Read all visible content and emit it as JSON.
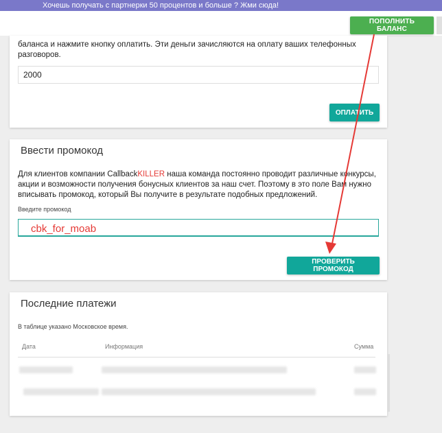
{
  "promo_banner": {
    "text": "Хочешь получать с партнерки 50 процентов и больше ? Жми сюда!"
  },
  "header": {
    "topup_button": "ПОПОЛНИТЬ БАЛАНС"
  },
  "payment_card": {
    "description": "баланса и нажмите кнопку оплатить. Эти деньги зачисляются на оплату ваших телефонных разговоров.",
    "amount_value": "2000",
    "pay_button": "ОПЛАТИТЬ"
  },
  "promo_card": {
    "title": "Ввести промокод",
    "text_before": "Для клиентов компании Callback",
    "text_brand": "KILLER",
    "text_after": " наша команда постоянно проводит различные конкурсы, акции и возможности получения бонусных клиентов за наш счет. Поэтому в это поле Вам нужно вписывать промокод, который Вы получите в результате подобных предложений.",
    "field_label": "Введите промокод",
    "promo_value": "cbk_for_moab",
    "check_button": "ПРОВЕРИТЬ ПРОМОКОД"
  },
  "payments_card": {
    "title": "Последние платежи",
    "note": "В таблице указано Московское время.",
    "columns": [
      "Дата",
      "Информация",
      "Сумма"
    ]
  },
  "colors": {
    "promo_bar": "#7a78c9",
    "green_button": "#4caf50",
    "teal_button": "#11a79a",
    "brand_red": "#e53935",
    "annotation_red": "#e53935"
  }
}
